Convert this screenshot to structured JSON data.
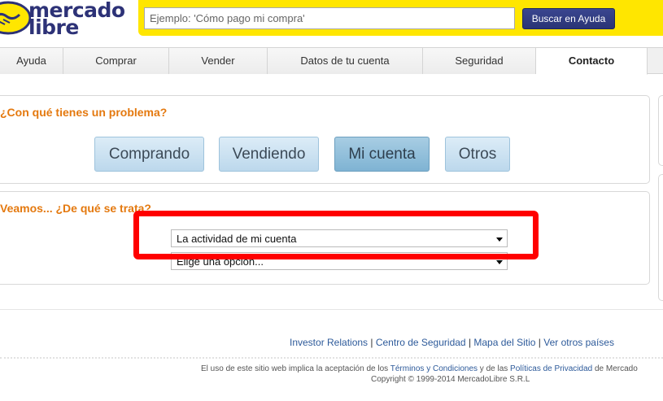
{
  "header": {
    "logo_line1": "mercado",
    "logo_line2": "libre",
    "search_placeholder": "Ejemplo: 'Cómo pago mi compra'",
    "search_button": "Buscar en Ayuda"
  },
  "tabs": [
    {
      "label": "Ayuda"
    },
    {
      "label": "Comprar"
    },
    {
      "label": "Vender"
    },
    {
      "label": "Datos de tu cuenta"
    },
    {
      "label": "Seguridad"
    },
    {
      "label": "Contacto",
      "active": true
    }
  ],
  "problem_section": {
    "title": "¿Con qué tienes un problema?",
    "options": [
      "Comprando",
      "Vendiendo",
      "Mi cuenta",
      "Otros"
    ],
    "selected": "Mi cuenta"
  },
  "topic_section": {
    "title": "Veamos... ¿De qué se trata?",
    "select1_value": "La actividad de mi cuenta",
    "select2_value": "Elige una opción..."
  },
  "footer": {
    "links": [
      "Investor Relations",
      "Centro de Seguridad",
      "Mapa del Sitio",
      "Ver otros países"
    ],
    "legal_prefix": "El uso de este sitio web implica la aceptación de los",
    "terms_link": "Términos y Condiciones",
    "legal_middle": "y de las",
    "privacy_link": "Políticas de Privacidad",
    "legal_suffix": "de Mercado",
    "copyright": "Copyright © 1999-2014 MercadoLibre S.R.L"
  },
  "colors": {
    "brand_yellow": "#ffe600",
    "brand_blue": "#2d3277",
    "accent_orange": "#e4790f",
    "link_blue": "#2d5a9a",
    "highlight_red": "#ff0000"
  }
}
